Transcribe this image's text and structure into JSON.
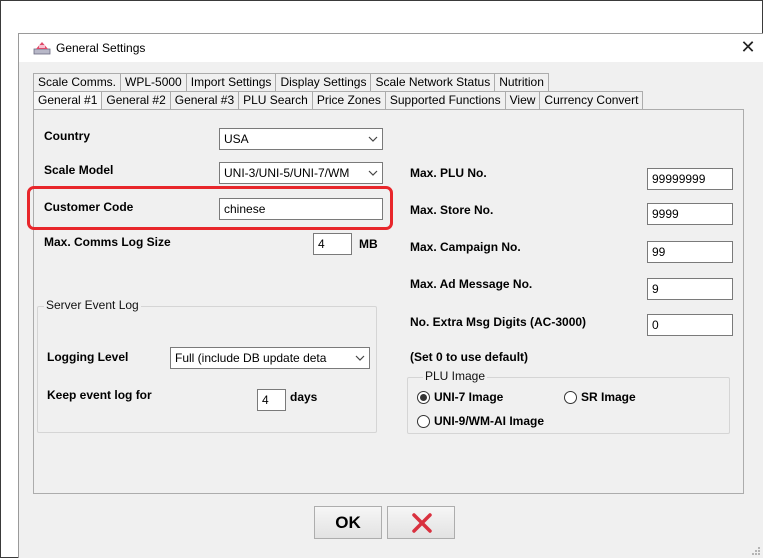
{
  "window": {
    "title": "General Settings",
    "close_icon": "close-icon",
    "app_icon": "scale-app-icon"
  },
  "tabs": {
    "row1": [
      "Scale Comms.",
      "WPL-5000",
      "Import Settings",
      "Display Settings",
      "Scale Network Status",
      "Nutrition"
    ],
    "row2": [
      "General #1",
      "General #2",
      "General #3",
      "PLU Search",
      "Price Zones",
      "Supported Functions",
      "View",
      "Currency Convert"
    ],
    "active": "General #1"
  },
  "left": {
    "country_label": "Country",
    "country_value": "USA",
    "scale_model_label": "Scale Model",
    "scale_model_value": "UNI-3/UNI-5/UNI-7/WM",
    "customer_code_label": "Customer Code",
    "customer_code_value": "chinese",
    "comms_log_label": "Max. Comms Log Size",
    "comms_log_value": "4",
    "comms_log_unit": "MB"
  },
  "server_event_log": {
    "legend": "Server Event Log",
    "logging_level_label": "Logging Level",
    "logging_level_value": "Full (include DB update deta",
    "keep_log_label": "Keep event log for",
    "keep_log_value": "4",
    "keep_log_unit": "days"
  },
  "right": {
    "max_plu_label": "Max. PLU No.",
    "max_plu_value": "99999999",
    "max_store_label": "Max. Store No.",
    "max_store_value": "9999",
    "max_campaign_label": "Max. Campaign No.",
    "max_campaign_value": "99",
    "max_ad_label": "Max. Ad Message No.",
    "max_ad_value": "9",
    "extra_digits_label": "No. Extra Msg Digits (AC-3000)",
    "extra_digits_value": "0",
    "default_note": "(Set 0 to use default)"
  },
  "plu_image": {
    "legend": "PLU Image",
    "options": [
      "UNI-7 Image",
      "SR Image",
      "UNI-9/WM-AI Image"
    ],
    "selected": "UNI-7 Image"
  },
  "buttons": {
    "ok_label": "OK",
    "cancel_icon": "cancel-x-icon"
  },
  "colors": {
    "highlight": "#e8262b",
    "cancel_x": "#d9313f"
  }
}
